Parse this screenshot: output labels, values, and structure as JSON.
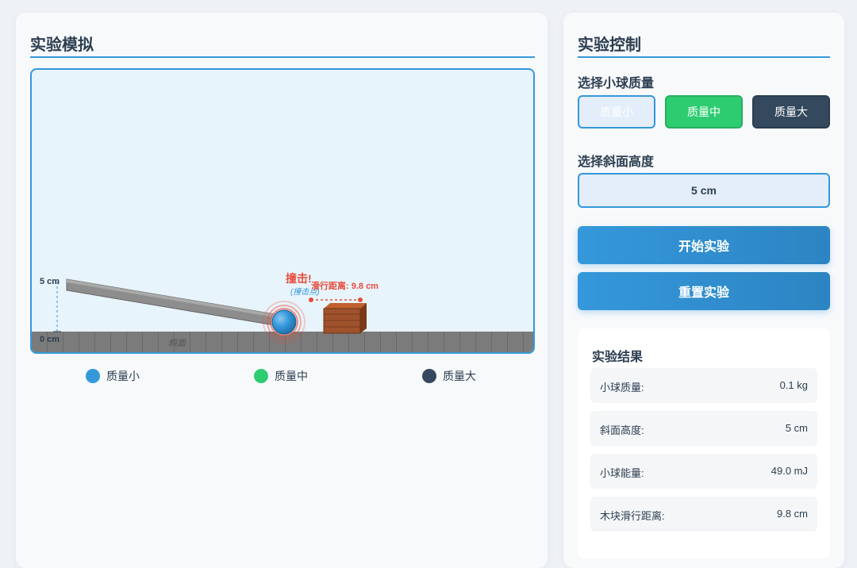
{
  "simulation": {
    "title": "实验模拟",
    "height_top_label": "5 cm",
    "height_bottom_label": "0 cm",
    "ramp_label": "斜面",
    "impact_label": "撞击!",
    "impact_sub_label": "(撞击点)",
    "slide_label": "滑行距离: 9.8 cm",
    "legend": [
      {
        "label": "质量小",
        "color": "#3498db"
      },
      {
        "label": "质量中",
        "color": "#2ecc71"
      },
      {
        "label": "质量大",
        "color": "#34495e"
      }
    ]
  },
  "controls": {
    "title": "实验控制",
    "mass_label": "选择小球质量",
    "mass_options": [
      {
        "label": "质量小",
        "selected": true
      },
      {
        "label": "质量中",
        "selected": false
      },
      {
        "label": "质量大",
        "selected": false
      }
    ],
    "height_label": "选择斜面高度",
    "height_value": "5 cm",
    "start_button": "开始实验",
    "reset_button": "重置实验"
  },
  "results": {
    "title": "实验结果",
    "rows": [
      {
        "key": "小球质量:",
        "value": "0.1 kg"
      },
      {
        "key": "斜面高度:",
        "value": "5 cm"
      },
      {
        "key": "小球能量:",
        "value": "49.0 mJ"
      },
      {
        "key": "木块滑行距离:",
        "value": "9.8 cm"
      }
    ]
  },
  "colors": {
    "accent": "#3498db",
    "medium": "#2ecc71",
    "large": "#34495e",
    "impact": "#e74c3c",
    "block": "#a0522d"
  }
}
